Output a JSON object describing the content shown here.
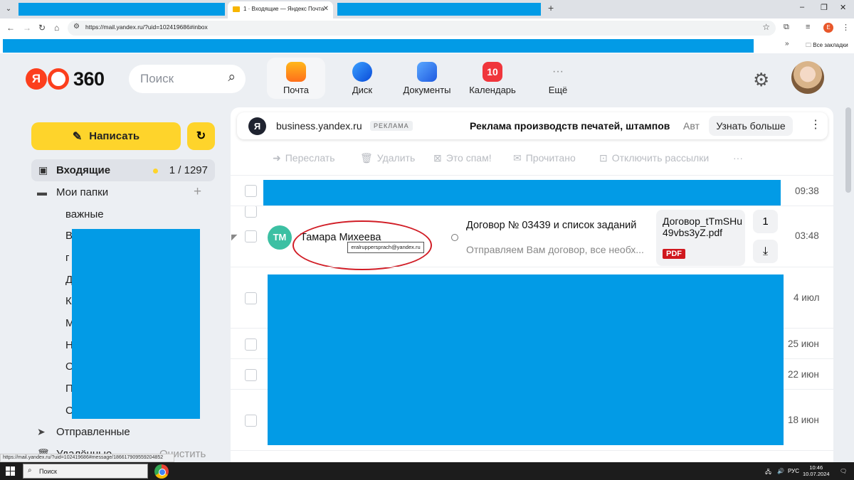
{
  "browser": {
    "tab_title": "1 · Входящие — Яндекс Почта",
    "url": "https://mail.yandex.ru/?uid=102419686#inbox",
    "profile_letter": "E",
    "bookmarks_all": "Все закладки",
    "status_link": "https://mail.yandex.ru/?uid=102419686#message/186617909559204852"
  },
  "header": {
    "logo_ya": "Я",
    "logo_num": "360",
    "search_placeholder": "Поиск",
    "services": [
      {
        "label": "Почта",
        "active": true
      },
      {
        "label": "Диск"
      },
      {
        "label": "Документы"
      },
      {
        "label": "Календарь",
        "badge": "10"
      },
      {
        "label": "Ещё"
      }
    ]
  },
  "sidebar": {
    "compose_label": "Написать",
    "inbox_label": "Входящие",
    "inbox_count": "1 / 1297",
    "folders_label": "Мои папки",
    "important_label": "важные",
    "partial_letters": [
      "В",
      "г",
      "Д",
      "К",
      "М",
      "Н",
      "О",
      "П",
      "С"
    ],
    "sent_label": "Отправленные",
    "deleted_label": "Удалённые",
    "clear_label": "Очистить"
  },
  "ad": {
    "logo": "Я",
    "domain": "business.yandex.ru",
    "tag": "РЕКЛАМА",
    "text": "Реклама производств печатей, штампов",
    "trunc": "Авт",
    "button": "Узнать больше"
  },
  "toolbar": {
    "forward": "Переслать",
    "delete": "Удалить",
    "spam": "Это спам!",
    "read": "Прочитано",
    "unsubscribe": "Отключить рассылки",
    "more": "···"
  },
  "messages": [
    {
      "time": "09:38"
    },
    {
      "initials": "ТМ",
      "sender": "Тамара Михеева",
      "tooltip": "eralruppersprach@yandex.ru",
      "subject": "Договор № 03439 и список заданий",
      "snippet": "Отправляем Вам договор, все необх...",
      "attachment": "Договор_tTmSHu49vbs3yZ.pdf",
      "attachment_type": "PDF",
      "attachment_count": "1",
      "time": "03:48"
    },
    {
      "time": "4 июл"
    },
    {
      "time": "25 июн"
    },
    {
      "time": "22 июн"
    },
    {
      "time": "18 июн"
    }
  ],
  "taskbar": {
    "search_placeholder": "Поиск",
    "lang": "РУС",
    "time": "10:46",
    "date": "10.07.2024"
  }
}
